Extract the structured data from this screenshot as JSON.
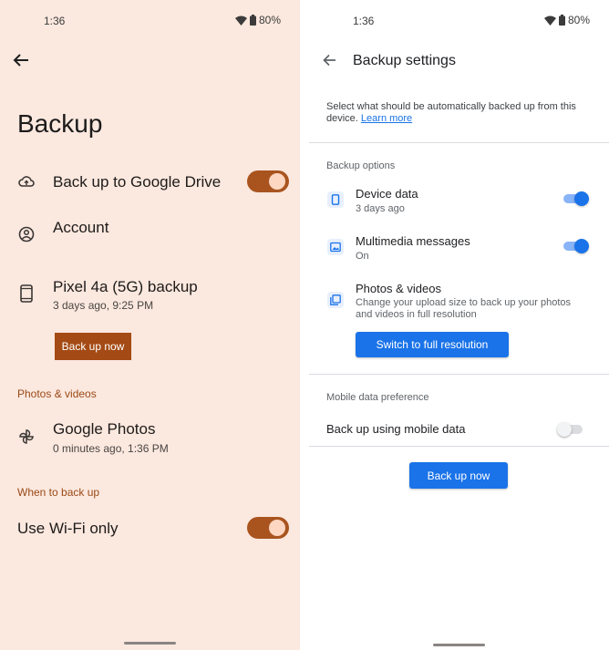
{
  "left_screen": {
    "status_bar": {
      "time": "1:36",
      "battery": "80%"
    },
    "back_icon": "arrow-left-icon",
    "title": "Backup",
    "drive_row": {
      "icon": "cloud-upload-icon",
      "label": "Back up to Google Drive",
      "toggle_on": true
    },
    "account_row": {
      "icon": "account-circle-icon",
      "label": "Account"
    },
    "device_row": {
      "icon": "phone-icon",
      "title": "Pixel 4a (5G) backup",
      "subtitle": "3 days ago, 9:25 PM"
    },
    "backup_button": "Back up now",
    "section_photos": "Photos & videos",
    "photos_row": {
      "icon": "pinwheel-icon",
      "title": "Google Photos",
      "subtitle": "0 minutes ago, 1:36 PM"
    },
    "section_when": "When to back up",
    "wifi_row": {
      "label": "Use Wi-Fi only",
      "toggle_on": true
    },
    "colors": {
      "background": "#fbe8df",
      "accent": "#a44a14"
    }
  },
  "right_screen": {
    "status_bar": {
      "time": "1:36",
      "battery": "80%"
    },
    "back_icon": "arrow-left-icon",
    "title": "Backup settings",
    "intro_text": "Select what should be automatically backed up from this",
    "intro_text_2": "device.",
    "learn_more": "Learn more",
    "section_options": "Backup options",
    "device_data": {
      "icon": "phone-icon",
      "title": "Device data",
      "subtitle": "3 days ago",
      "toggle_on": true
    },
    "mms": {
      "icon": "image-message-icon",
      "title": "Multimedia messages",
      "subtitle": "On",
      "toggle_on": true
    },
    "photos": {
      "icon": "photo-library-icon",
      "title": "Photos & videos",
      "subtitle_1": "Change your upload size to back up your photos",
      "subtitle_2": "and videos in full resolution",
      "button": "Switch to full resolution"
    },
    "section_mobile": "Mobile data preference",
    "mobile_data": {
      "label": "Back up using mobile data",
      "toggle_on": false
    },
    "backup_button": "Back up now",
    "colors": {
      "accent": "#1a73e8"
    }
  }
}
